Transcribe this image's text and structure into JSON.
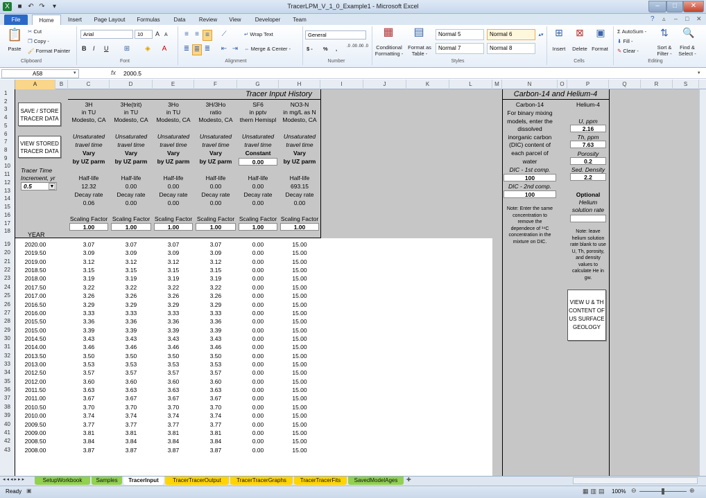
{
  "window": {
    "title": "TracerLPM_V_1_0_Example1 - Microsoft Excel"
  },
  "qat": {
    "icons": [
      "excel-logo-icon",
      "save-icon",
      "undo-icon",
      "redo-icon",
      "customize-qat-icon"
    ]
  },
  "ribbon_tabs": [
    "File",
    "Home",
    "Insert",
    "Page Layout",
    "Formulas",
    "Data",
    "Review",
    "View",
    "Developer",
    "Team"
  ],
  "ribbon": {
    "clipboard": {
      "paste": "Paste",
      "cut": "Cut",
      "copy": "Copy -",
      "format_painter": "Format Painter",
      "label": "Clipboard"
    },
    "font": {
      "name": "Arial",
      "size": "10",
      "bold": "B",
      "italic": "I",
      "underline": "U",
      "grow": "A",
      "shrink": "A",
      "label": "Font"
    },
    "alignment": {
      "wrap": "Wrap Text",
      "merge": "Merge & Center -",
      "label": "Alignment"
    },
    "number": {
      "format": "General",
      "currency": "$ -",
      "percent": "%",
      "comma": ",",
      "inc_dec": ".0 .00",
      "dec_dec": ".00 .0",
      "label": "Number"
    },
    "styles": {
      "conditional": "Conditional Formatting -",
      "format_table": "Format as Table -",
      "normal5": "Normal 5",
      "normal6": "Normal 6",
      "normal7": "Normal 7",
      "normal8": "Normal 8",
      "label": "Styles"
    },
    "cells": {
      "insert": "Insert",
      "delete": "Delete",
      "format": "Format",
      "label": "Cells"
    },
    "editing": {
      "autosum": "AutoSum -",
      "fill": "Fill -",
      "clear": "Clear -",
      "sort": "Sort & Filter -",
      "find": "Find & Select -",
      "label": "Editing"
    }
  },
  "formula_bar": {
    "name_box": "A58",
    "fx": "fx",
    "value": "2000.5"
  },
  "columns": [
    "A",
    "B",
    "C",
    "D",
    "E",
    "F",
    "G",
    "H",
    "I",
    "J",
    "K",
    "L",
    "M",
    "N",
    "O",
    "P",
    "Q",
    "R",
    "S"
  ],
  "sheet": {
    "title": "Tracer Input History",
    "buttons": {
      "save": "SAVE / STORE TRACER DATA",
      "view": "VIEW STORED TRACER DATA",
      "geology": "VIEW U & TH CONTENT OF US SURFACE GEOLOGY"
    },
    "tracer_time_label": "Tracer Time",
    "increment_label": "Increment, yr",
    "increment_value": "0.5",
    "year_label": "YEAR",
    "tracers": [
      {
        "name": "3H",
        "unit": "in TU",
        "site": "Modesto, CA",
        "uz1": "Unsaturated",
        "uz2": "travel time",
        "mode": "Vary",
        "mode2": "by UZ parm",
        "hl": "Half-life",
        "hl_val": "12.32",
        "dr": "Decay rate",
        "dr_val": "0.06",
        "sf": "Scaling Factor",
        "sf_val": "1.00"
      },
      {
        "name": "3He(trit)",
        "unit": "in TU",
        "site": "Modesto, CA",
        "uz1": "Unsaturated",
        "uz2": "travel time",
        "mode": "Vary",
        "mode2": "by UZ parm",
        "hl": "Half-life",
        "hl_val": "0.00",
        "dr": "Decay rate",
        "dr_val": "0.00",
        "sf": "Scaling Factor",
        "sf_val": "1.00"
      },
      {
        "name": "3Ho",
        "unit": "in TU",
        "site": "Modesto, CA",
        "uz1": "Unsaturated",
        "uz2": "travel time",
        "mode": "Vary",
        "mode2": "by UZ parm",
        "hl": "Half-life",
        "hl_val": "0.00",
        "dr": "Decay rate",
        "dr_val": "0.00",
        "sf": "Scaling Factor",
        "sf_val": "1.00"
      },
      {
        "name": "3H/3Ho",
        "unit": "ratio",
        "site": "Modesto, CA",
        "uz1": "Unsaturated",
        "uz2": "travel time",
        "mode": "Vary",
        "mode2": "by UZ parm",
        "hl": "Half-life",
        "hl_val": "0.00",
        "dr": "Decay rate",
        "dr_val": "0.00",
        "sf": "Scaling Factor",
        "sf_val": "1.00"
      },
      {
        "name": "SF6",
        "unit": "in pptv",
        "site": "thern Hemispl",
        "uz1": "Unsaturated",
        "uz2": "travel time",
        "mode": "Constant",
        "mode2": "0.00",
        "hl": "Half-life",
        "hl_val": "0.00",
        "dr": "Decay rate",
        "dr_val": "0.00",
        "sf": "Scaling Factor",
        "sf_val": "1.00"
      },
      {
        "name": "NO3-N",
        "unit": "in mg/L as N",
        "site": "Modesto, CA",
        "uz1": "Unsaturated",
        "uz2": "travel time",
        "mode": "Vary",
        "mode2": "by UZ parm",
        "hl": "Half-life",
        "hl_val": "693.15",
        "dr": "Decay rate",
        "dr_val": "0.00",
        "sf": "Scaling Factor",
        "sf_val": "1.00"
      }
    ],
    "rows": [
      {
        "r": "19",
        "year": "2020.00",
        "v": [
          "3.07",
          "3.07",
          "3.07",
          "3.07",
          "0.00",
          "15.00"
        ]
      },
      {
        "r": "20",
        "year": "2019.50",
        "v": [
          "3.09",
          "3.09",
          "3.09",
          "3.09",
          "0.00",
          "15.00"
        ]
      },
      {
        "r": "21",
        "year": "2019.00",
        "v": [
          "3.12",
          "3.12",
          "3.12",
          "3.12",
          "0.00",
          "15.00"
        ]
      },
      {
        "r": "22",
        "year": "2018.50",
        "v": [
          "3.15",
          "3.15",
          "3.15",
          "3.15",
          "0.00",
          "15.00"
        ]
      },
      {
        "r": "23",
        "year": "2018.00",
        "v": [
          "3.19",
          "3.19",
          "3.19",
          "3.19",
          "0.00",
          "15.00"
        ]
      },
      {
        "r": "24",
        "year": "2017.50",
        "v": [
          "3.22",
          "3.22",
          "3.22",
          "3.22",
          "0.00",
          "15.00"
        ]
      },
      {
        "r": "25",
        "year": "2017.00",
        "v": [
          "3.26",
          "3.26",
          "3.26",
          "3.26",
          "0.00",
          "15.00"
        ]
      },
      {
        "r": "26",
        "year": "2016.50",
        "v": [
          "3.29",
          "3.29",
          "3.29",
          "3.29",
          "0.00",
          "15.00"
        ]
      },
      {
        "r": "27",
        "year": "2016.00",
        "v": [
          "3.33",
          "3.33",
          "3.33",
          "3.33",
          "0.00",
          "15.00"
        ]
      },
      {
        "r": "28",
        "year": "2015.50",
        "v": [
          "3.36",
          "3.36",
          "3.36",
          "3.36",
          "0.00",
          "15.00"
        ]
      },
      {
        "r": "29",
        "year": "2015.00",
        "v": [
          "3.39",
          "3.39",
          "3.39",
          "3.39",
          "0.00",
          "15.00"
        ]
      },
      {
        "r": "30",
        "year": "2014.50",
        "v": [
          "3.43",
          "3.43",
          "3.43",
          "3.43",
          "0.00",
          "15.00"
        ]
      },
      {
        "r": "31",
        "year": "2014.00",
        "v": [
          "3.46",
          "3.46",
          "3.46",
          "3.46",
          "0.00",
          "15.00"
        ]
      },
      {
        "r": "32",
        "year": "2013.50",
        "v": [
          "3.50",
          "3.50",
          "3.50",
          "3.50",
          "0.00",
          "15.00"
        ]
      },
      {
        "r": "33",
        "year": "2013.00",
        "v": [
          "3.53",
          "3.53",
          "3.53",
          "3.53",
          "0.00",
          "15.00"
        ]
      },
      {
        "r": "34",
        "year": "2012.50",
        "v": [
          "3.57",
          "3.57",
          "3.57",
          "3.57",
          "0.00",
          "15.00"
        ]
      },
      {
        "r": "35",
        "year": "2012.00",
        "v": [
          "3.60",
          "3.60",
          "3.60",
          "3.60",
          "0.00",
          "15.00"
        ]
      },
      {
        "r": "36",
        "year": "2011.50",
        "v": [
          "3.63",
          "3.63",
          "3.63",
          "3.63",
          "0.00",
          "15.00"
        ]
      },
      {
        "r": "37",
        "year": "2011.00",
        "v": [
          "3.67",
          "3.67",
          "3.67",
          "3.67",
          "0.00",
          "15.00"
        ]
      },
      {
        "r": "38",
        "year": "2010.50",
        "v": [
          "3.70",
          "3.70",
          "3.70",
          "3.70",
          "0.00",
          "15.00"
        ]
      },
      {
        "r": "39",
        "year": "2010.00",
        "v": [
          "3.74",
          "3.74",
          "3.74",
          "3.74",
          "0.00",
          "15.00"
        ]
      },
      {
        "r": "40",
        "year": "2009.50",
        "v": [
          "3.77",
          "3.77",
          "3.77",
          "3.77",
          "0.00",
          "15.00"
        ]
      },
      {
        "r": "41",
        "year": "2009.00",
        "v": [
          "3.81",
          "3.81",
          "3.81",
          "3.81",
          "0.00",
          "15.00"
        ]
      },
      {
        "r": "42",
        "year": "2008.50",
        "v": [
          "3.84",
          "3.84",
          "3.84",
          "3.84",
          "0.00",
          "15.00"
        ]
      },
      {
        "r": "43",
        "year": "2008.00",
        "v": [
          "3.87",
          "3.87",
          "3.87",
          "3.87",
          "0.00",
          "15.00"
        ]
      }
    ],
    "carbon": {
      "title": "Carbon-14 and Helium-4",
      "c14_head": "Carbon-14",
      "he4_head": "Helium-4",
      "c14_text": [
        "For binary mixing",
        "models, enter the",
        "dissolved",
        "inorganic carbon",
        "(DIC) content of",
        "each parcel of",
        "water"
      ],
      "dic1_label": "DIC - 1st comp.",
      "dic1_val": "100",
      "dic2_label": "DIC - 2nd comp.",
      "dic2_val": "100",
      "note1": [
        "Note: Enter the same",
        "concentration to",
        "remove the",
        "dependece of ¹⁴C",
        "concentration in the",
        "mixture on DIC."
      ],
      "u_label": "U, ppm",
      "u_val": "2.16",
      "th_label": "Th, ppm",
      "th_val": "7.63",
      "por_label": "Porosity",
      "por_val": "0.2",
      "den_label": "Sed. Density",
      "den_val": "2.2",
      "optional": "Optional",
      "he_rate": [
        "Helium",
        "solution rate"
      ],
      "note2": [
        "Note: leave",
        "helium solution",
        "rate blank to use",
        "U, Th, porosity,",
        "and density",
        "values to",
        "calculate He in",
        "gw."
      ]
    }
  },
  "row_headers": [
    "1",
    "2",
    "3",
    "4",
    "5",
    "6",
    "7",
    "8",
    "9",
    "10",
    "11",
    "12",
    "13",
    "14",
    "15",
    "16",
    "17",
    "18"
  ],
  "sheet_tabs": [
    "SetupWorkbook",
    "Samples",
    "TracerInput",
    "TracerTracerOutput",
    "TracerTracerGraphs",
    "TracerTracerFits",
    "SavedModelAges"
  ],
  "status": {
    "ready": "Ready",
    "zoom": "100%"
  },
  "colors": {
    "gray": "#c6c6c6",
    "tab_green": "#92d050",
    "tab_yellow": "#ffd400",
    "accent": "#2a6ac6"
  }
}
